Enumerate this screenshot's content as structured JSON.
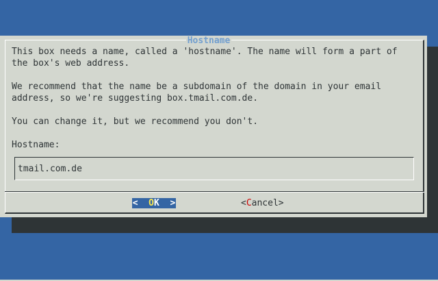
{
  "dialog": {
    "title": "Hostname",
    "message_lines": [
      "This box needs a name, called a 'hostname'. The name will form a part of",
      "the box's web address.",
      "We recommend that the name be a subdomain of the domain in your email",
      "address, so we're suggesting box.tmail.com.de.",
      "You can change it, but we recommend you don't."
    ],
    "field_label": "Hostname:",
    "field_value": "tmail.com.de"
  },
  "buttons": {
    "ok": {
      "left": "<  ",
      "hotkey": "O",
      "rest": "K",
      "right": "  >"
    },
    "cancel": {
      "left": "<",
      "hotkey": "C",
      "rest": "ancel",
      "right": ">"
    }
  },
  "colors": {
    "background": "#3465a4",
    "dialog": "#d3d7cf",
    "title": "#729fcf",
    "shadow": "#2e3436",
    "hotkey_selected": "#fce94f",
    "hotkey": "#cc0000"
  }
}
